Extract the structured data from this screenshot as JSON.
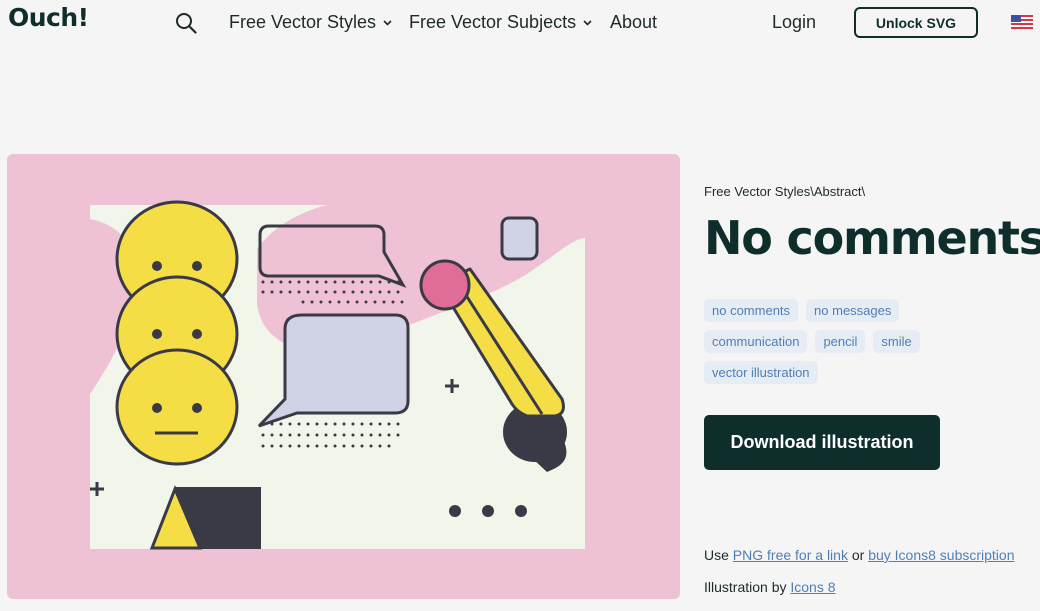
{
  "header": {
    "logo": "Ouch!",
    "nav": [
      {
        "label": "Free Vector Styles",
        "has_dropdown": true
      },
      {
        "label": "Free Vector Subjects",
        "has_dropdown": true
      },
      {
        "label": "About",
        "has_dropdown": false
      }
    ],
    "login": "Login",
    "unlock": "Unlock SVG",
    "icons": {
      "search": "search-icon",
      "flag": "us-flag-icon"
    }
  },
  "illustration": {
    "background": "#efc1d4",
    "palette": {
      "yellow": "#f5dd46",
      "outline": "#3a3a46",
      "lavender": "#d0d3e6",
      "cream": "#f2f5e9",
      "magenta": "#e06c98",
      "dark": "#3a3a46"
    }
  },
  "info": {
    "breadcrumb": "Free Vector Styles\\Abstract\\",
    "title": "No comments",
    "tags": [
      [
        "no comments",
        "no messages"
      ],
      [
        "communication",
        "pencil",
        "smile"
      ],
      [
        "vector illustration"
      ]
    ],
    "download": "Download illustration",
    "license": {
      "prefix": "Use ",
      "link1": "PNG free for a link",
      "middle": " or ",
      "link2": "buy Icons8 subscription"
    },
    "credit": {
      "prefix": "Illustration by ",
      "link": "Icons 8"
    }
  }
}
